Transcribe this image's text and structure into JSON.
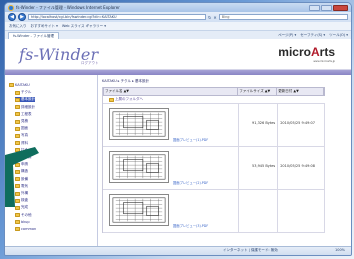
{
  "window": {
    "title": "fs-Winder - ファイル管理 - Windows Internet Explorer"
  },
  "address": {
    "url": "http://localhost/cgi-bin/fswinder.cgi?dir=KAITAKU",
    "search_placeholder": "Bing"
  },
  "favorites": {
    "items": [
      "お気に入り",
      "おすすめサイト ▾",
      "Web スライス ギャラリー ▾"
    ]
  },
  "tab": {
    "label": "fs-Winder - ファイル管理",
    "tools": [
      "ページ(P) ▾",
      "セーフティ(S) ▾",
      "ツール(O) ▾"
    ]
  },
  "header": {
    "brand": "fs-Winder",
    "brand_sub": "ログアウト",
    "logo_main": "micro",
    "logo_accent": "A",
    "logo_tail": "rts",
    "logo_sub": "www.microarts.jp"
  },
  "tree": {
    "items": [
      {
        "label": "KAITAKU",
        "selected": false
      },
      {
        "label": "チクル",
        "selected": false
      },
      {
        "label": "基本設計",
        "selected": true
      },
      {
        "label": "詳細設計",
        "selected": false
      },
      {
        "label": "工程表",
        "selected": false
      },
      {
        "label": "見積",
        "selected": false
      },
      {
        "label": "図面",
        "selected": false
      },
      {
        "label": "写真",
        "selected": false
      },
      {
        "label": "資料",
        "selected": false
      },
      {
        "label": "打合せ",
        "selected": false
      },
      {
        "label": "議事録",
        "selected": false
      },
      {
        "label": "申請",
        "selected": false
      },
      {
        "label": "構造",
        "selected": false
      },
      {
        "label": "設備",
        "selected": false
      },
      {
        "label": "電気",
        "selected": false
      },
      {
        "label": "外構",
        "selected": false
      },
      {
        "label": "検査",
        "selected": false
      },
      {
        "label": "完成",
        "selected": false
      },
      {
        "label": "その他",
        "selected": false
      },
      {
        "label": "bkup",
        "selected": false
      },
      {
        "label": "common",
        "selected": false
      }
    ]
  },
  "main": {
    "breadcrumb": "KAITAKU ▸ チクル ▸ 基本設計",
    "columns": [
      "ファイル名 ▲▼",
      "ファイルサイズ ▲▼",
      "更新日付 ▲▼"
    ],
    "up_label": "上層のフォルダへ",
    "rows": [
      {
        "download": "図面プレビュー(1).PDF",
        "size": "91,326 Bytes",
        "date": "2010/05/25 9:49:07"
      },
      {
        "download": "図面プレビュー(2).PDF",
        "size": "53,945 Bytes",
        "date": "2010/05/25 9:49:08"
      },
      {
        "download": "図面プレビュー(3).PDF",
        "size": "",
        "date": ""
      }
    ]
  },
  "status": {
    "zone": "インターネット | 保護モード: 無効",
    "zoom": "100%"
  }
}
